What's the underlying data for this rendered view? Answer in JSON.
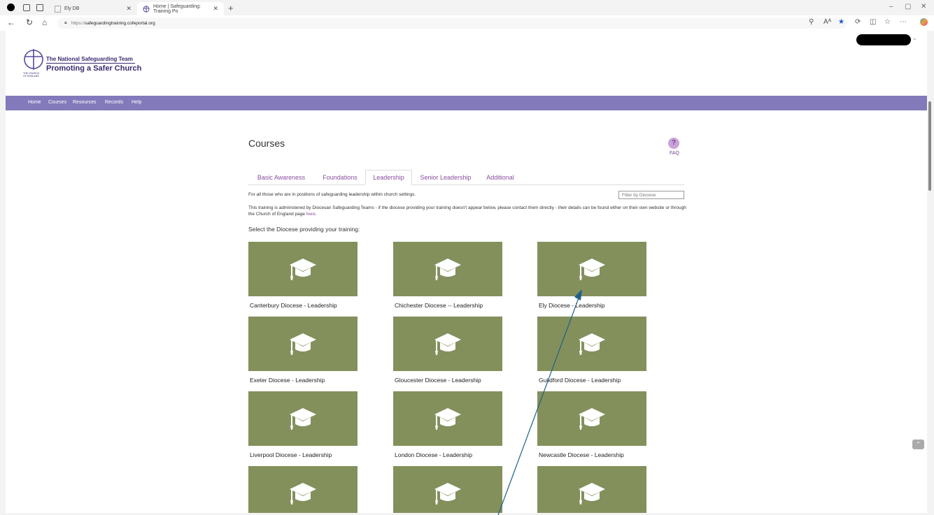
{
  "browser": {
    "tabs": [
      {
        "label": "Ely DB"
      },
      {
        "label": "Home | Safeguarding: Training Po"
      }
    ],
    "url_prefix": "https://",
    "url_domain": "safeguardingtraining.cofeportal.org"
  },
  "site": {
    "logo_line1": "The National Safeguarding Team",
    "logo_line2": "Promoting a Safer Church",
    "logo_small": "THE CHURCH OF ENGLAND",
    "nav": [
      "Home",
      "Courses",
      "Resources",
      "Records",
      "Help"
    ]
  },
  "main": {
    "title": "Courses",
    "faq_icon": "?",
    "faq_label": "FAQ",
    "tabs": [
      "Basic Awareness",
      "Foundations",
      "Leadership",
      "Senior Leadership",
      "Additional"
    ],
    "selected_tab": "Leadership",
    "description": "For all those who are in positions of safeguarding leadership within church settings.",
    "filter_placeholder": "Filter by Diocese",
    "info_text": "This training is administered by Diocesan Safeguarding Teams - if the diocese providing your training doesn't appear below, please contact them directly - their details can be found either on their own website or through the Church of England page ",
    "info_link": "here",
    "info_end": ".",
    "select_label": "Select the Diocese providing your training:",
    "courses": [
      "Canterbury Diocese - Leadership",
      "Chichester Diocese -- Leadership",
      "Ely Diocese - Leadership",
      "Exeter Diocese - Leadership",
      "Gloucester Diocese - Leadership",
      "Guildford Diocese - Leadership",
      "Liverpool Diocese - Leadership",
      "London Diocese - Leadership",
      "Newcastle Diocese - Leadership",
      "",
      "",
      ""
    ]
  },
  "colors": {
    "nav_bg": "#827aba",
    "card_bg": "#83905c",
    "accent": "#8a4e9e",
    "annotation_arrow": "#1f5f8b"
  },
  "icons": [
    "mortarboard-icon",
    "help-icon",
    "scroll-top-icon",
    "chevron-down-icon"
  ]
}
